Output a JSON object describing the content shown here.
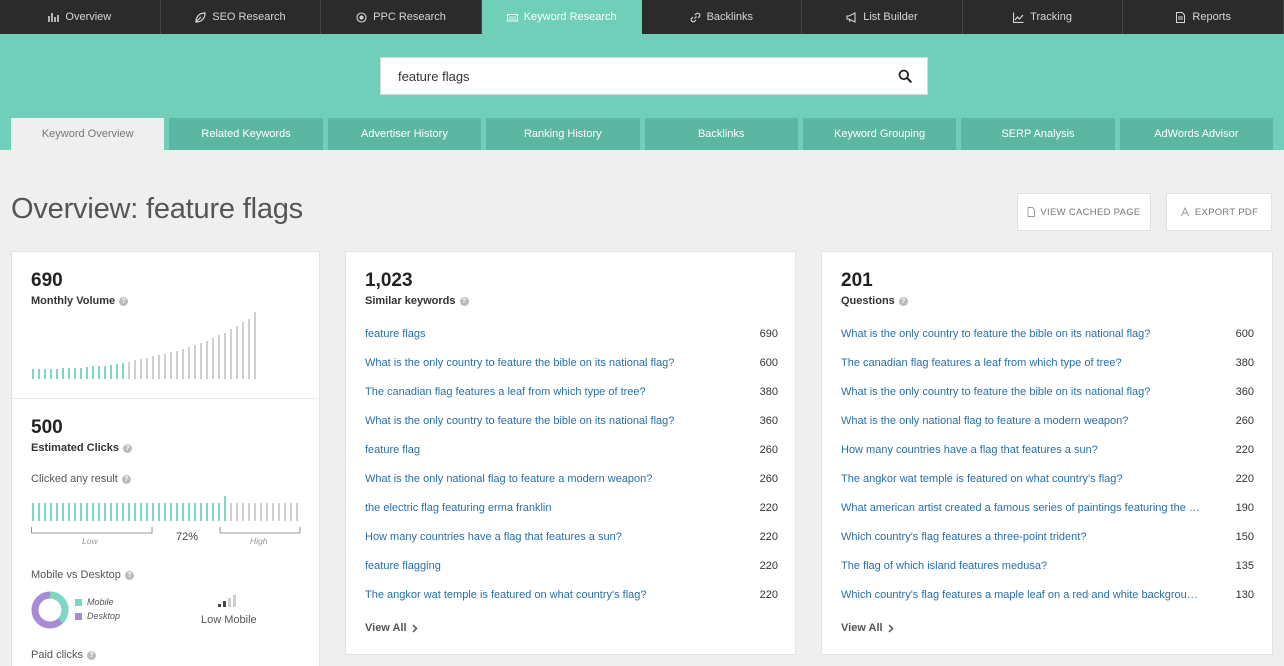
{
  "topnav": [
    {
      "label": "Overview",
      "icon": "bar-chart-icon"
    },
    {
      "label": "SEO Research",
      "icon": "leaf-icon"
    },
    {
      "label": "PPC Research",
      "icon": "target-icon"
    },
    {
      "label": "Keyword Research",
      "icon": "keyboard-icon",
      "active": true
    },
    {
      "label": "Backlinks",
      "icon": "link-icon"
    },
    {
      "label": "List Builder",
      "icon": "megaphone-icon"
    },
    {
      "label": "Tracking",
      "icon": "line-chart-icon"
    },
    {
      "label": "Reports",
      "icon": "document-icon"
    }
  ],
  "search": {
    "value": "feature flags"
  },
  "subtabs": [
    {
      "label": "Keyword Overview",
      "active": true
    },
    {
      "label": "Related Keywords"
    },
    {
      "label": "Advertiser History"
    },
    {
      "label": "Ranking History"
    },
    {
      "label": "Backlinks"
    },
    {
      "label": "Keyword Grouping"
    },
    {
      "label": "SERP Analysis"
    },
    {
      "label": "AdWords Advisor"
    }
  ],
  "page": {
    "title": "Overview: feature flags",
    "btn_cached": "VIEW CACHED PAGE",
    "btn_export": "EXPORT PDF"
  },
  "monthly_volume": {
    "value": "690",
    "label": "Monthly Volume",
    "bars_teal": [
      0.15,
      0.15,
      0.15,
      0.15,
      0.15,
      0.16,
      0.16,
      0.17,
      0.17,
      0.18,
      0.19,
      0.2,
      0.2,
      0.21,
      0.22,
      0.24
    ],
    "bars_grey": [
      0.26,
      0.28,
      0.3,
      0.32,
      0.34,
      0.36,
      0.38,
      0.4,
      0.42,
      0.45,
      0.48,
      0.51,
      0.54,
      0.57,
      0.61,
      0.65,
      0.69,
      0.74,
      0.79,
      0.85,
      0.9,
      1.0
    ]
  },
  "estimated_clicks": {
    "value": "500",
    "label": "Estimated Clicks",
    "clicked_any_label": "Clicked any result",
    "clicked_pct": 72,
    "pct_label": "72%",
    "low_label": "Low",
    "high_label": "High"
  },
  "mobile_desktop": {
    "label": "Mobile vs Desktop",
    "legend_mobile": "Mobile",
    "legend_desktop": "Desktop",
    "mobile_share": 0.38,
    "mobile_color": "#7ed6c4",
    "desktop_color": "#a78bd4",
    "signal_label": "Low Mobile"
  },
  "paid_clicks": {
    "label": "Paid clicks"
  },
  "similar": {
    "value": "1,023",
    "label": "Similar keywords",
    "items": [
      {
        "kw": "feature flags",
        "vol": "690"
      },
      {
        "kw": "What is the only country to feature the bible on its national flag?",
        "vol": "600"
      },
      {
        "kw": "The canadian flag features a leaf from which type of tree?",
        "vol": "380"
      },
      {
        "kw": "What is the only country to feature the bible on its national flag?",
        "vol": "360"
      },
      {
        "kw": "feature flag",
        "vol": "260"
      },
      {
        "kw": "What is the only national flag to feature a modern weapon?",
        "vol": "260"
      },
      {
        "kw": "the electric flag featuring erma franklin",
        "vol": "220"
      },
      {
        "kw": "How many countries have a flag that features a sun?",
        "vol": "220"
      },
      {
        "kw": "feature flagging",
        "vol": "220"
      },
      {
        "kw": "The angkor wat temple is featured on what country's flag?",
        "vol": "220"
      }
    ],
    "view_all": "View All"
  },
  "questions": {
    "value": "201",
    "label": "Questions",
    "items": [
      {
        "kw": "What is the only country to feature the bible on its national flag?",
        "vol": "600"
      },
      {
        "kw": "The canadian flag features a leaf from which type of tree?",
        "vol": "380"
      },
      {
        "kw": "What is the only country to feature the bible on its national flag?",
        "vol": "360"
      },
      {
        "kw": "What is the only national flag to feature a modern weapon?",
        "vol": "260"
      },
      {
        "kw": "How many countries have a flag that features a sun?",
        "vol": "220"
      },
      {
        "kw": "The angkor wat temple is featured on what country's flag?",
        "vol": "220"
      },
      {
        "kw": "What american artist created a famous series of paintings featuring the flag?",
        "vol": "190"
      },
      {
        "kw": "Which country's flag features a three-point trident?",
        "vol": "150"
      },
      {
        "kw": "The flag of which island features medusa?",
        "vol": "135"
      },
      {
        "kw": "Which country's flag features a maple leaf on a red and white background?",
        "vol": "130"
      }
    ],
    "view_all": "View All"
  },
  "colors": {
    "teal": "#6fcfb9",
    "bar_teal": "#7ed6c4",
    "bar_grey": "#cfcfcf",
    "link": "#2a6fa8"
  }
}
